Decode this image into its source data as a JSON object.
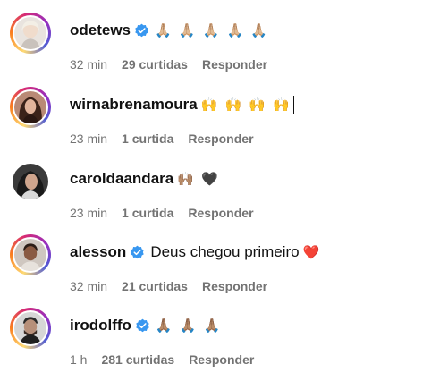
{
  "comments": [
    {
      "username": "odetews",
      "verified": true,
      "text": "",
      "emojis": "🙏🏼 🙏🏼 🙏🏼 🙏🏼 🙏🏼",
      "time": "32 min",
      "likes": "29 curtidas",
      "reply": "Responder"
    },
    {
      "username": "wirnabrenamoura",
      "verified": false,
      "text": "",
      "emojis": "🙌 🙌 🙌 🙌",
      "time": "23 min",
      "likes": "1 curtida",
      "reply": "Responder"
    },
    {
      "username": "caroldaandara",
      "verified": false,
      "text": "",
      "emojis": "🙌🏽 🖤",
      "time": "23 min",
      "likes": "1 curtida",
      "reply": "Responder"
    },
    {
      "username": "alesson",
      "verified": true,
      "text": "Deus chegou primeiro",
      "emojis": "❤️",
      "time": "32 min",
      "likes": "21 curtidas",
      "reply": "Responder"
    },
    {
      "username": "irodolffo",
      "verified": true,
      "text": "",
      "emojis": "🙏🏽 🙏🏽 🙏🏽",
      "time": "1 h",
      "likes": "281 curtidas",
      "reply": "Responder"
    }
  ],
  "colors": {
    "verified_badge": "#3897f0",
    "meta_text": "#737373",
    "primary_text": "#111111"
  }
}
